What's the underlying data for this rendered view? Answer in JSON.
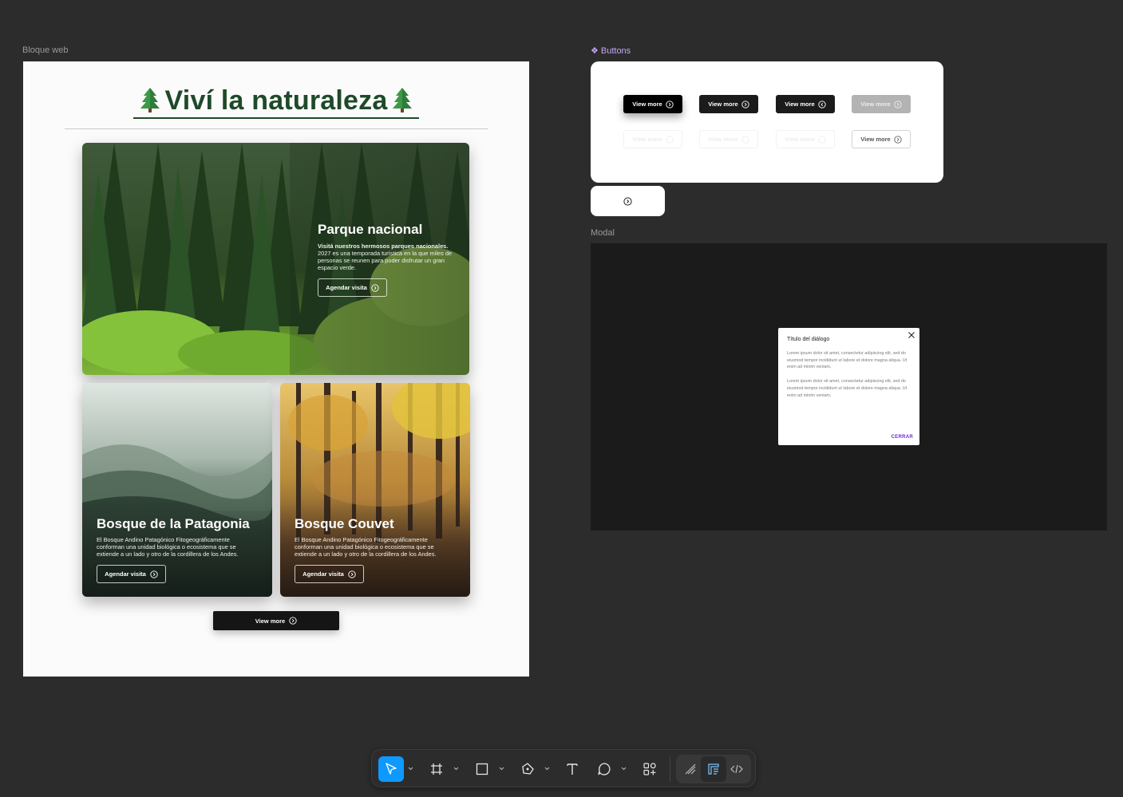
{
  "canvas": {
    "background": "#2c2c2c"
  },
  "frames": {
    "web_label": "Bloque web",
    "buttons_label": "Buttons",
    "modal_label": "Modal"
  },
  "web": {
    "heading": "Viví la naturaleza",
    "heading_color": "#1e4a2a",
    "cards": [
      {
        "title": "Parque nacional",
        "desc_bold": "Visitá nuestros hermosos parques nacionales.",
        "desc": "2027 es una temporada turística en la que miles de personas se reunen para poder disfrutar un gran espacio verde.",
        "button": "Agendar visita"
      },
      {
        "title": "Bosque de la Patagonia",
        "desc": "El Bosque Andino Patagónico Fitogeográficamente conforman una unidad biológica o ecosistema que se extiende a un lado y otro de la cordillera de los Andes.",
        "button": "Agendar visita"
      },
      {
        "title": "Bosque Couvet",
        "desc": "El Bosque Andino Patagónico Fitogeográficamente conforman una unidad biológica o ecosistema que se extiende a un lado y otro de la cordillera de los Andes.",
        "button": "Agendar visita"
      }
    ],
    "view_more": "View more"
  },
  "buttons_component": {
    "variants": [
      {
        "label": "View more",
        "state": "black"
      },
      {
        "label": "View more",
        "state": "dark"
      },
      {
        "label": "View more",
        "state": "dark"
      },
      {
        "label": "View more",
        "state": "disabled"
      },
      {
        "label": "View more",
        "state": "ghost"
      },
      {
        "label": "View more",
        "state": "ghost"
      },
      {
        "label": "View more",
        "state": "ghost"
      },
      {
        "label": "View more",
        "state": "outline"
      }
    ]
  },
  "modal": {
    "title": "Título del diálogo",
    "paragraph_1": "Lorem ipsum dolor sit amet, consectetur adipiscing elit, sed do eiusmod tempor incididunt ut labore et dolore magna aliqua. Ut enim ad minim veniam,",
    "paragraph_2": "Lorem ipsum dolor sit amet, consectetur adipiscing elit, sed do eiusmod tempor incididunt ut labore et dolore magna aliqua. Ut enim ad minim veniam,",
    "action": "CERRAR",
    "action_color": "#6b2bd3"
  },
  "toolbar": {
    "tools": [
      "move-tool",
      "frame-tool",
      "rectangle-tool",
      "pen-tool",
      "text-tool",
      "comment-tool",
      "actions-tool"
    ],
    "modes": [
      "draw-mode",
      "design-mode",
      "dev-mode"
    ],
    "active_tool": "move-tool",
    "active_mode": "design-mode",
    "accent": "#0d99ff"
  }
}
